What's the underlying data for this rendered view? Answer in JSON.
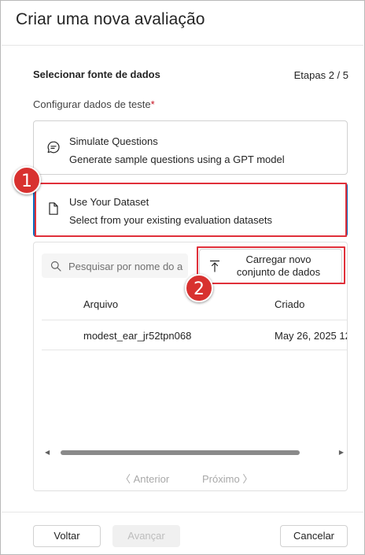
{
  "dialog": {
    "title": "Criar uma nova avaliação",
    "section_title": "Selecionar fonte de dados",
    "step": "Etapas 2 / 5",
    "field_label": "Configurar dados de teste",
    "required_mark": "*"
  },
  "options": [
    {
      "title": "Simulate Questions",
      "description": "Generate sample questions using a GPT model",
      "icon": "chat-icon",
      "selected": false
    },
    {
      "title": "Use Your Dataset",
      "description": "Select from your existing evaluation datasets",
      "icon": "document-icon",
      "selected": true
    }
  ],
  "dataset_panel": {
    "search_placeholder": "Pesquisar por nome do a",
    "upload_label": "Carregar novo conjunto de dados",
    "columns": [
      "Arquivo",
      "Criado"
    ],
    "rows": [
      {
        "file": "modest_ear_jr52tpn068",
        "created": "May 26, 2025 12"
      }
    ],
    "pager": {
      "prev": "Anterior",
      "next": "Próximo"
    }
  },
  "annotations": {
    "badge1": "1",
    "badge2": "2",
    "color": "#d8312f"
  },
  "footer": {
    "back": "Voltar",
    "next": "Avançar",
    "cancel": "Cancelar"
  },
  "colors": {
    "accent": "#0f6cbd",
    "highlight": "#e0303a",
    "required": "#c50f1f"
  }
}
